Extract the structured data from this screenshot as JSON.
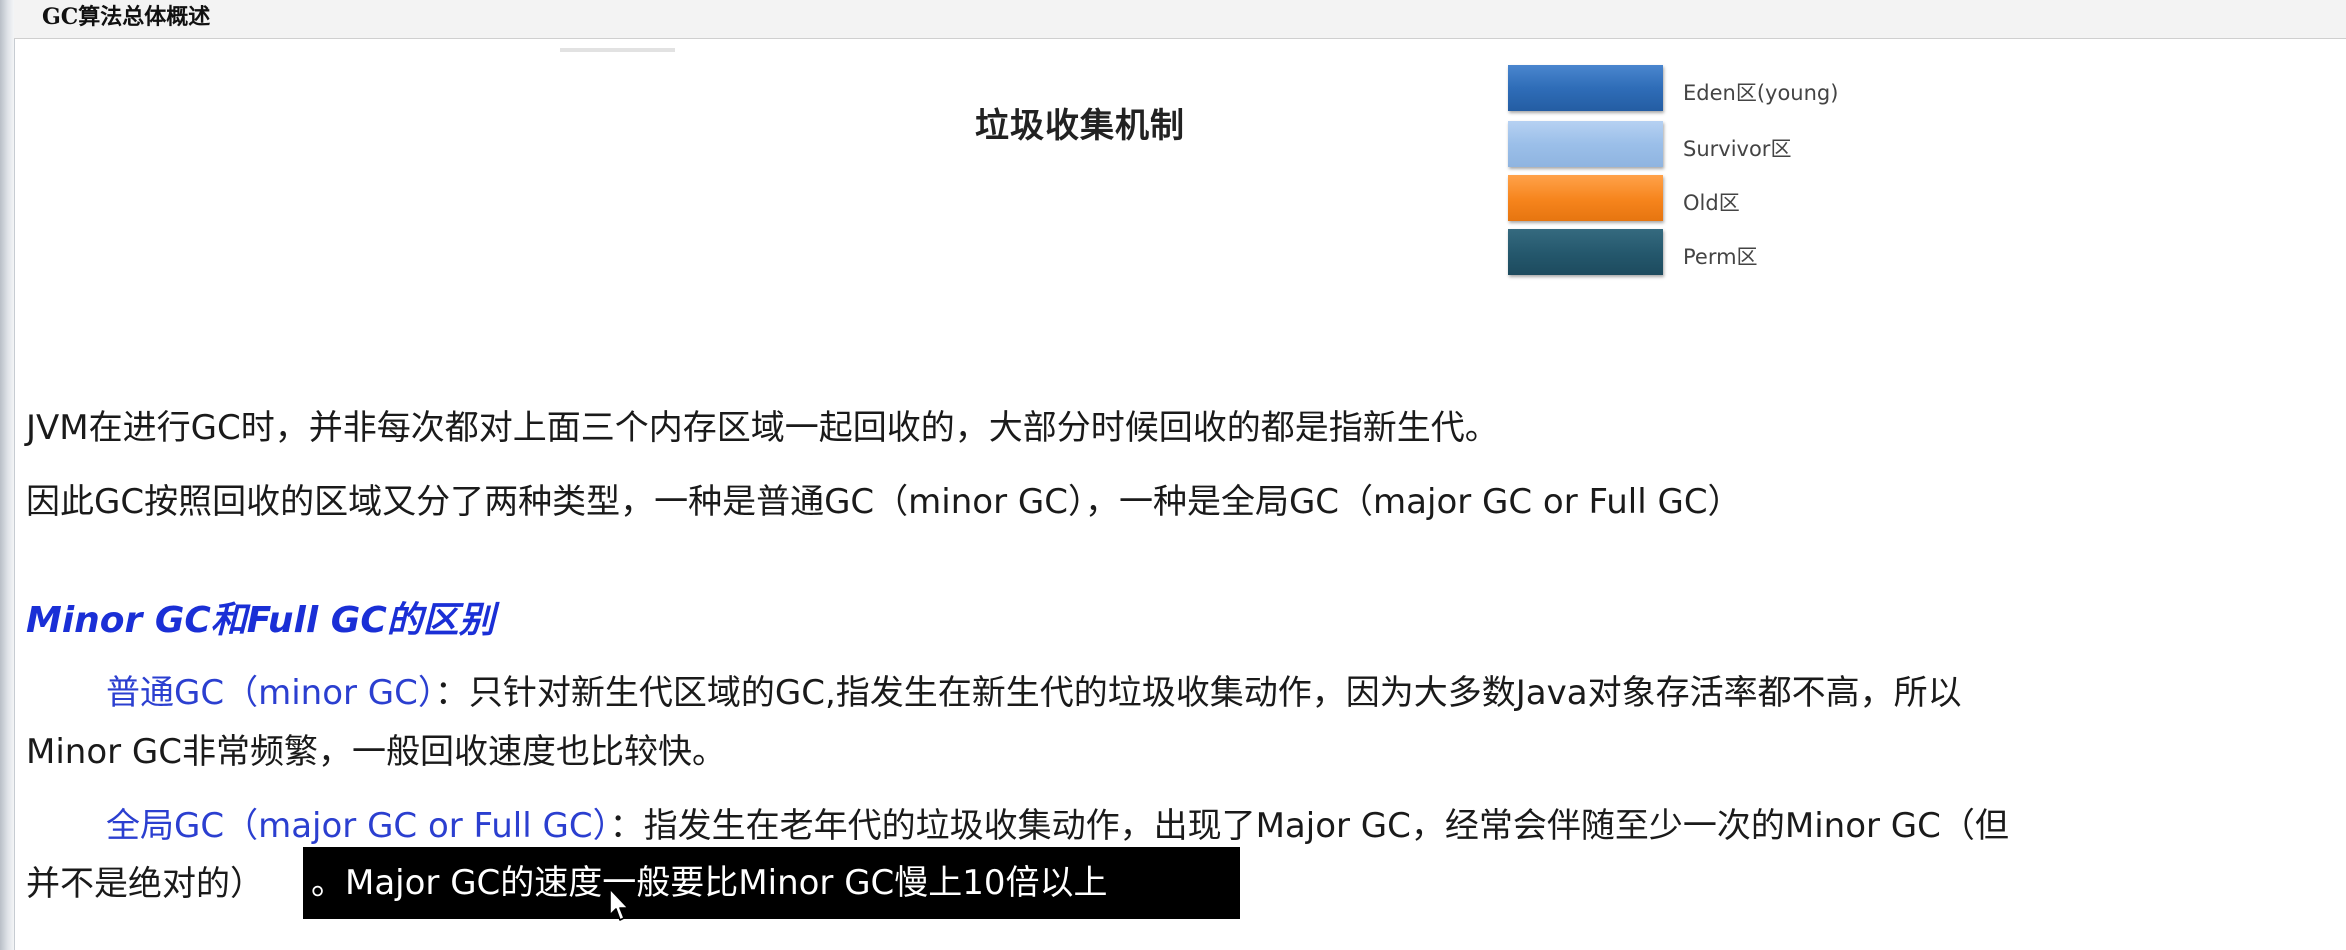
{
  "title_bar": {
    "title": "GC算法总体概述"
  },
  "slide": {
    "heading": "垃圾收集机制",
    "legend": [
      {
        "label": "Eden区(young)",
        "color": "#2f6db8"
      },
      {
        "label": "Survivor区",
        "color": "#9bbfe9"
      },
      {
        "label": "Old区",
        "color": "#f6841c"
      },
      {
        "label": "Perm区",
        "color": "#24576c"
      }
    ]
  },
  "body": {
    "line1": "JVM在进行GC时，并非每次都对上面三个内存区域一起回收的，大部分时候回收的都是指新生代。",
    "line2": "因此GC按照回收的区域又分了两种类型，一种是普通GC（minor GC），一种是全局GC（major GC or Full GC）",
    "section_heading": "Minor GC和Full GC的区别",
    "minor_term": "普通GC（minor GC）",
    "minor_desc_1": "：只针对新生代区域的GC,指发生在新生代的垃圾收集动作，因为大多数Java对象存活率都不高，所以",
    "minor_desc_2": "Minor GC非常频繁，一般回收速度也比较快。",
    "major_term": "全局GC（major GC or Full GC）",
    "major_desc_1": "：指发生在老年代的垃圾收集动作，出现了Major GC，经常会伴随至少一次的Minor GC（但",
    "major_desc_2": "并不是绝对的）",
    "highlighted": "。Major GC的速度一般要比Minor GC慢上10倍以上"
  },
  "icons": {
    "cursor": "mouse-pointer-icon"
  }
}
